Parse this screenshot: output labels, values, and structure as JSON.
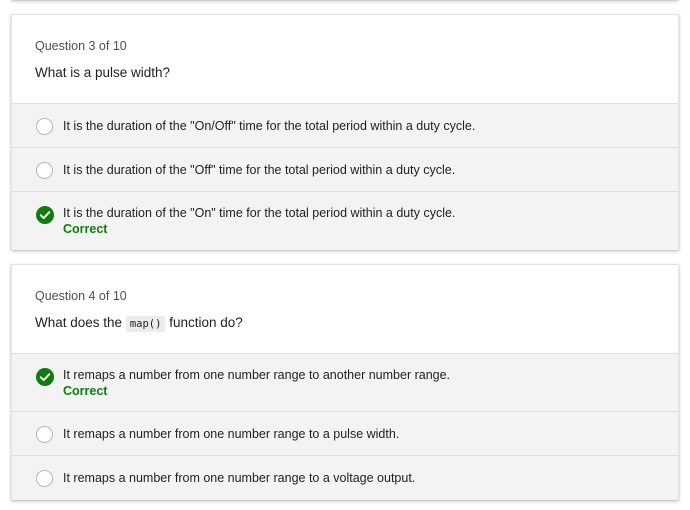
{
  "questions": [
    {
      "count": "Question 3 of 10",
      "text": "What is a pulse width?",
      "options": [
        {
          "label": "It is the duration of the \"On/Off\" time for the total period within a duty cycle.",
          "selected": false
        },
        {
          "label": "It is the duration of the \"Off\" time for the total period within a duty cycle.",
          "selected": false
        },
        {
          "label": "It is the duration of the \"On\" time for the total period within a duty cycle.",
          "selected": true,
          "status": "Correct"
        }
      ]
    },
    {
      "count": "Question 4 of 10",
      "text_before": "What does the",
      "code": "map()",
      "text_after": "function do?",
      "options": [
        {
          "label": "It remaps a number from one number range to another number range.",
          "selected": true,
          "status": "Correct"
        },
        {
          "label": "It remaps a number from one number range to a pulse width.",
          "selected": false
        },
        {
          "label": "It remaps a number from one number range to a voltage output.",
          "selected": false
        }
      ]
    }
  ],
  "icons": {
    "selected": "checkmark-circle-icon",
    "unselected": "radio-unselected-icon"
  },
  "colors": {
    "correct": "#107c10",
    "option_background": "#f3f3f3",
    "card_background": "#ffffff"
  }
}
